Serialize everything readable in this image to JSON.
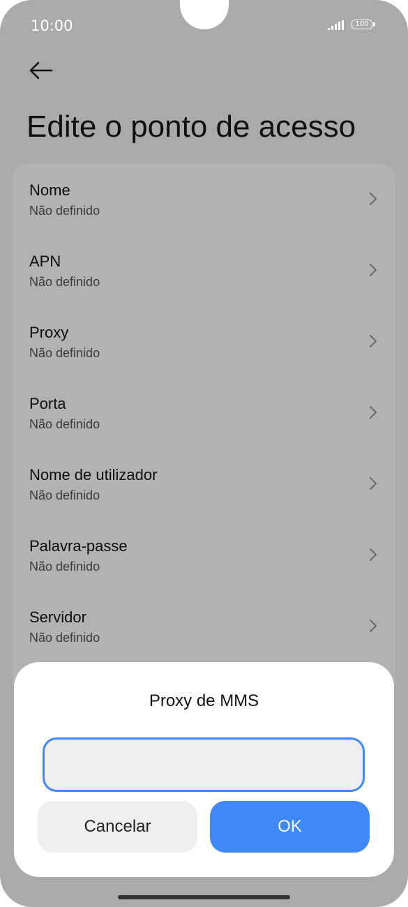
{
  "status_bar": {
    "time": "10:00",
    "battery": "100"
  },
  "header": {
    "title": "Edite o ponto de acesso"
  },
  "settings": {
    "items": [
      {
        "label": "Nome",
        "value": "Não definido"
      },
      {
        "label": "APN",
        "value": "Não definido"
      },
      {
        "label": "Proxy",
        "value": "Não definido"
      },
      {
        "label": "Porta",
        "value": "Não definido"
      },
      {
        "label": "Nome de utilizador",
        "value": "Não definido"
      },
      {
        "label": "Palavra-passe",
        "value": "Não definido"
      },
      {
        "label": "Servidor",
        "value": "Não definido"
      }
    ]
  },
  "dialog": {
    "title": "Proxy de MMS",
    "input_value": "",
    "cancel_label": "Cancelar",
    "ok_label": "OK"
  },
  "colors": {
    "accent": "#3e88f7",
    "scrim_background": "#aaaaaa",
    "dialog_background": "#ffffff",
    "secondary_button": "#eeeeee"
  },
  "icons": {
    "back": "arrow-left-icon",
    "chevron": "chevron-right-icon",
    "signal": "signal-icon",
    "battery": "battery-icon"
  }
}
